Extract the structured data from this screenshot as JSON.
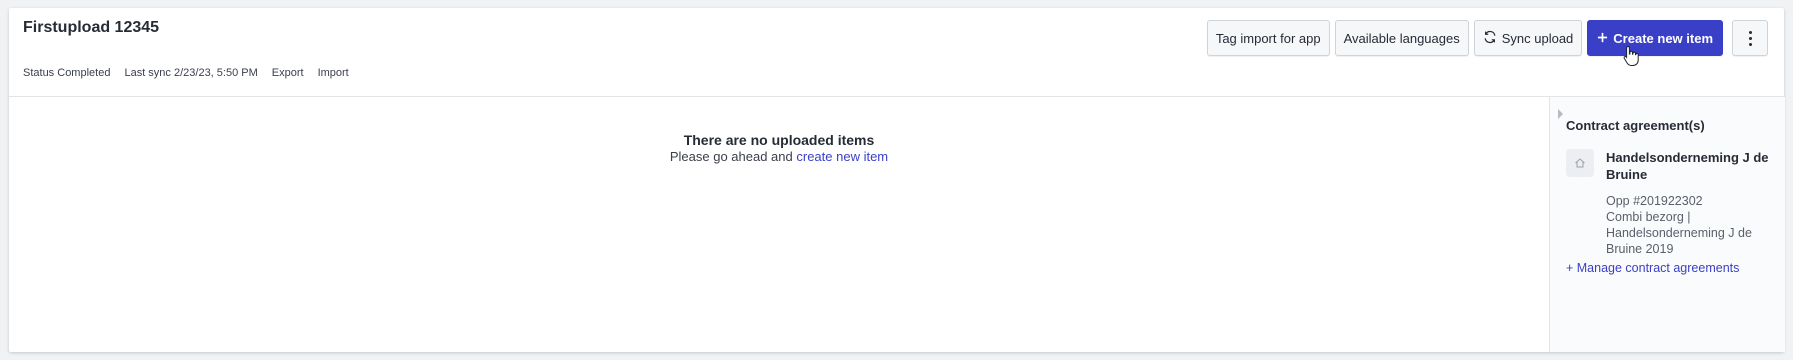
{
  "header": {
    "title": "Firstupload 12345",
    "status_label": "Status",
    "status_value": "Completed",
    "last_sync_label": "Last sync",
    "last_sync_value": "2/23/23, 5:50 PM",
    "export_label": "Export",
    "import_label": "Import"
  },
  "actions": {
    "tag_import": "Tag import for app",
    "available_languages": "Available languages",
    "sync_upload": "Sync upload",
    "create_new_item": "Create new item",
    "sync_icon": "sync-icon",
    "plus_icon": "plus-icon",
    "more_icon": "kebab-menu-icon"
  },
  "empty_state": {
    "title": "There are no uploaded items",
    "prefix": "Please go ahead and",
    "link": "create new item"
  },
  "sidebar": {
    "title": "Contract agreement(s)",
    "agreement": {
      "name": "Handelsonderneming J de Bruine",
      "icon": "home-icon",
      "lines": [
        "Opp #201922302",
        "Combi bezorg |",
        "Handelsonderneming J de",
        "Bruine 2019"
      ]
    },
    "manage_link": "+ Manage contract agreements"
  },
  "colors": {
    "accent": "#3a3fc7",
    "border": "#cfd3da",
    "background": "#f1f2f4"
  }
}
